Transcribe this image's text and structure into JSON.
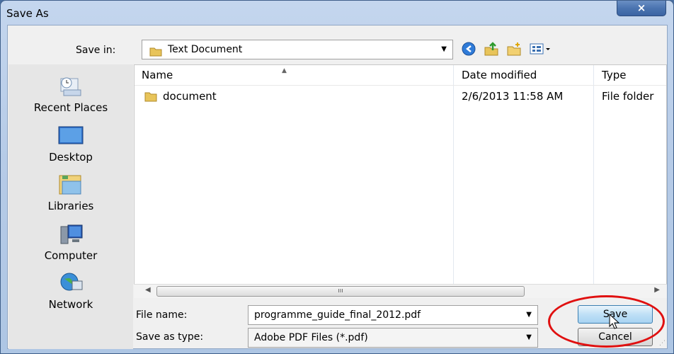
{
  "window": {
    "title": "Save As",
    "close_symbol": "×"
  },
  "toolbar": {
    "save_in_label": "Save in:",
    "save_in_value": "Text Document",
    "icons": [
      "back-icon",
      "up-folder-icon",
      "new-folder-icon",
      "views-menu-icon"
    ]
  },
  "places": [
    {
      "label": "Recent Places",
      "icon": "recent-places-icon"
    },
    {
      "label": "Desktop",
      "icon": "desktop-icon"
    },
    {
      "label": "Libraries",
      "icon": "libraries-icon"
    },
    {
      "label": "Computer",
      "icon": "computer-icon"
    },
    {
      "label": "Network",
      "icon": "network-icon"
    }
  ],
  "file_list": {
    "columns": [
      "Name",
      "Date modified",
      "Type"
    ],
    "rows": [
      {
        "name": "document",
        "date": "2/6/2013 11:58 AM",
        "type": "File folder"
      }
    ],
    "scroll_thumb_glyph": "ııı"
  },
  "form": {
    "file_name_label": "File name:",
    "file_name_value": "programme_guide_final_2012.pdf",
    "save_type_label": "Save as type:",
    "save_type_value": "Adobe PDF Files (*.pdf)"
  },
  "buttons": {
    "save": "Save",
    "cancel": "Cancel"
  },
  "colors": {
    "highlight_ring": "#e01010",
    "folder": "#e8c45a",
    "title_bar": "#c4d6ee"
  }
}
